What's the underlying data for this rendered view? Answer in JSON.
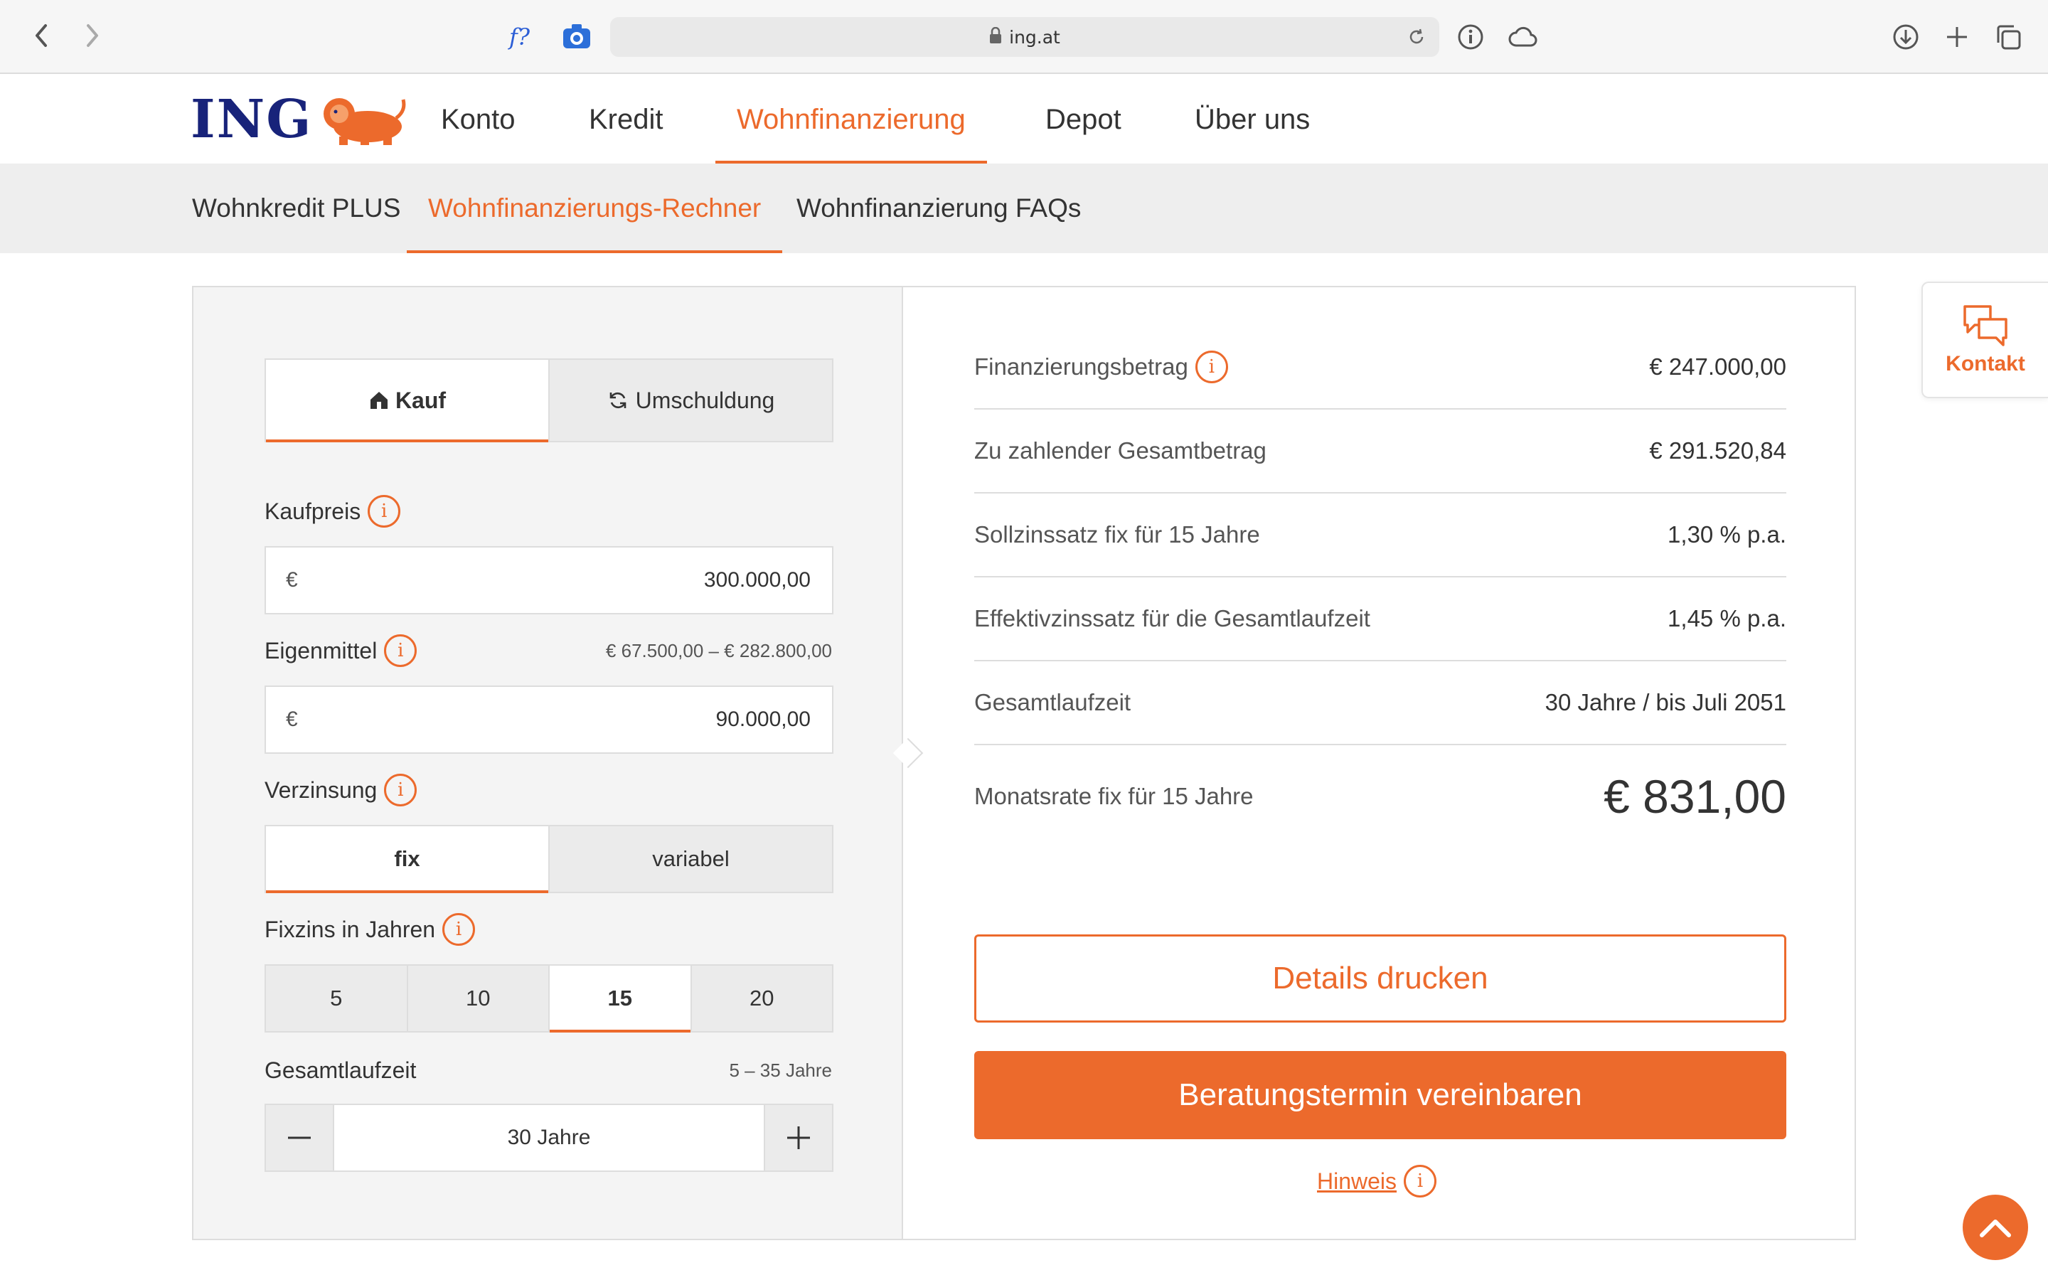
{
  "browser": {
    "url": "ing.at",
    "fx_label": "f?"
  },
  "nav": {
    "logo": "ING",
    "items": [
      {
        "label": "Konto"
      },
      {
        "label": "Kredit"
      },
      {
        "label": "Wohnfinanzierung"
      },
      {
        "label": "Depot"
      },
      {
        "label": "Über uns"
      }
    ],
    "active": "Wohnfinanzierung"
  },
  "subnav": {
    "items": [
      {
        "label": "Wohnkredit PLUS"
      },
      {
        "label": "Wohnfinanzierungs-Rechner"
      },
      {
        "label": "Wohnfinanzierung FAQs"
      }
    ],
    "active": "Wohnfinanzierungs-Rechner"
  },
  "calculator": {
    "mode_tabs": [
      {
        "label": "Kauf",
        "icon": "house-icon"
      },
      {
        "label": "Umschuldung",
        "icon": "refresh-icon"
      }
    ],
    "mode_active": "Kauf",
    "kaufpreis": {
      "label": "Kaufpreis",
      "currency": "€",
      "value": "300.000,00"
    },
    "eigenmittel": {
      "label": "Eigenmittel",
      "range": "€ 67.500,00 – € 282.800,00",
      "currency": "€",
      "value": "90.000,00"
    },
    "verzinsung": {
      "label": "Verzinsung",
      "options": [
        "fix",
        "variabel"
      ],
      "active": "fix"
    },
    "fixzins": {
      "label": "Fixzins in Jahren",
      "options": [
        "5",
        "10",
        "15",
        "20"
      ],
      "active": "15"
    },
    "laufzeit": {
      "label": "Gesamtlaufzeit",
      "range": "5 – 35 Jahre",
      "value": "30 Jahre"
    }
  },
  "results": {
    "rows": [
      {
        "label": "Finanzierungsbetrag",
        "value": "€ 247.000,00"
      },
      {
        "label": "Zu zahlender Gesamtbetrag",
        "value": "€ 291.520,84"
      },
      {
        "label": "Sollzinssatz fix für 15 Jahre",
        "value": "1,30 % p.a."
      },
      {
        "label": "Effektivzinssatz für die Gesamtlaufzeit",
        "value": "1,45 % p.a."
      },
      {
        "label": "Gesamtlaufzeit",
        "value": "30 Jahre / bis Juli 2051"
      }
    ],
    "monthly": {
      "label": "Monatsrate fix für 15 Jahre",
      "value": "€ 831,00"
    },
    "print_button": "Details drucken",
    "appointment_button": "Beratungstermin vereinbaren",
    "hint_link": "Hinweis"
  },
  "floating": {
    "kontakt_label": "Kontakt"
  },
  "colors": {
    "accent": "#ec6a2c",
    "brand_navy": "#18237a"
  }
}
